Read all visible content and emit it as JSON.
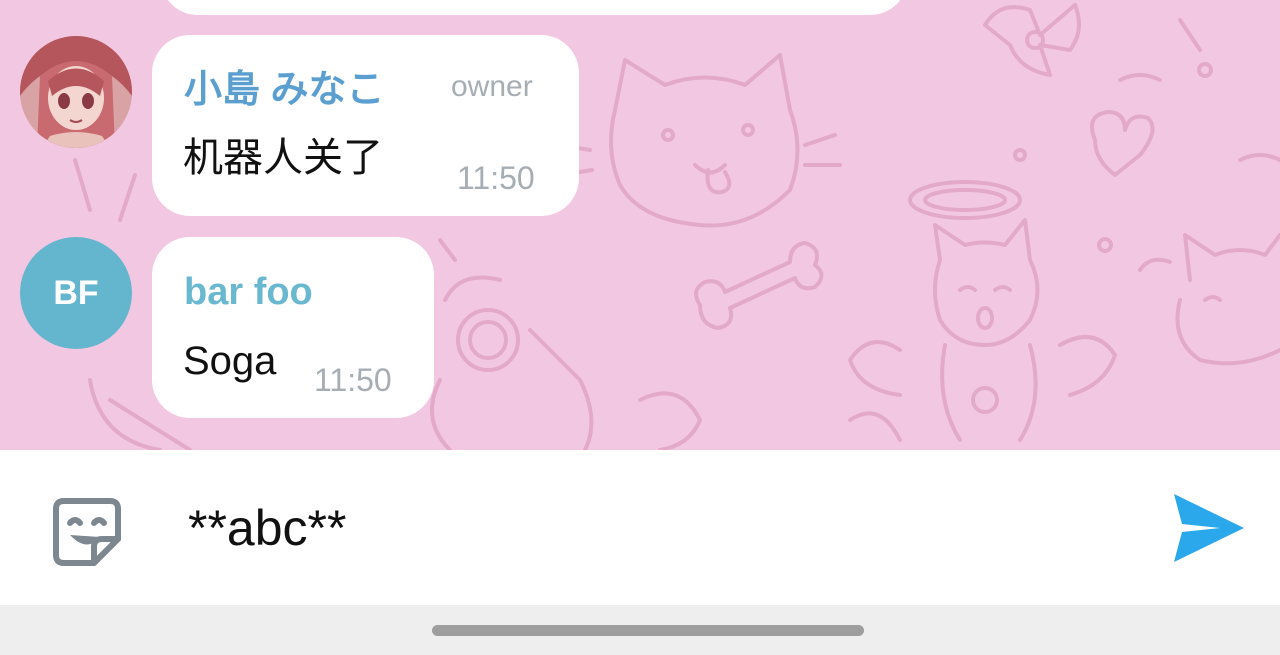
{
  "colors": {
    "chat_background": "#f2c7e1",
    "doodle_stroke": "#e3a9c9",
    "owner_name": "#5a9fd0",
    "member_name": "#6ab8d0",
    "send_accent": "#2ba8ec"
  },
  "messages": [
    {
      "sender": "小島 みなこ",
      "role": "owner",
      "text": "机器人关了",
      "time": "11:50",
      "avatar_icon": "anime-girl-avatar"
    },
    {
      "sender": "bar foo",
      "text": "Soga",
      "time": "11:50",
      "avatar_initials": "BF"
    }
  ],
  "composer": {
    "value": "**abc**",
    "emoji_icon": "sticker-emoji-icon",
    "send_icon": "send-icon"
  }
}
